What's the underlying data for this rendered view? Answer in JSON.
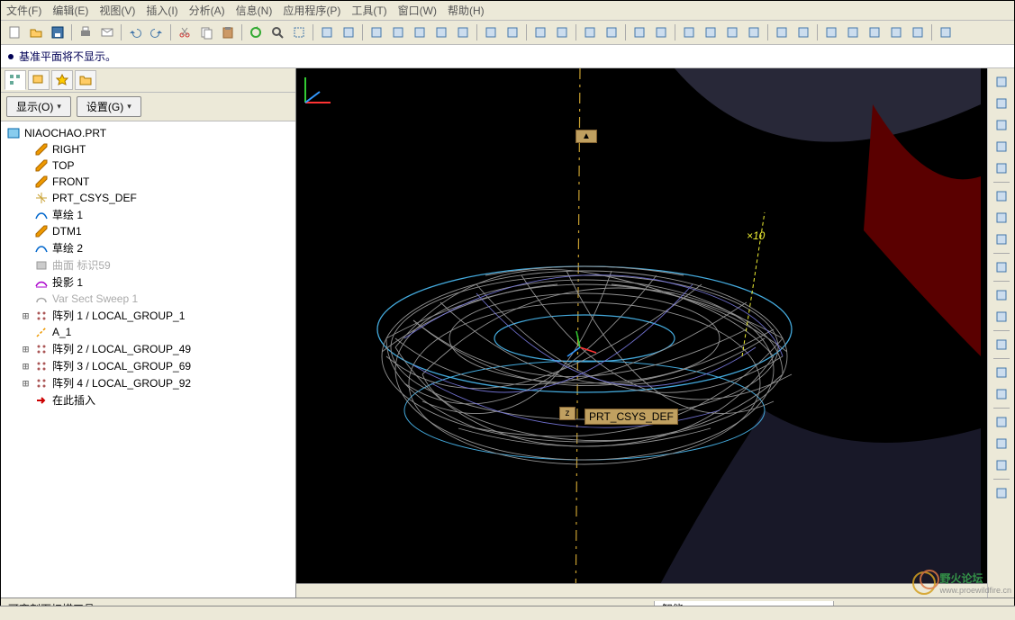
{
  "menu": [
    "文件(F)",
    "编辑(E)",
    "视图(V)",
    "插入(I)",
    "分析(A)",
    "信息(N)",
    "应用程序(P)",
    "工具(T)",
    "窗口(W)",
    "帮助(H)"
  ],
  "message": "基准平面将不显示。",
  "controls": {
    "show": "显示(O)",
    "settings": "设置(G)"
  },
  "tree_root": "NIAOCHAO.PRT",
  "tree_items": [
    {
      "icon": "plane",
      "label": "RIGHT",
      "faded": false
    },
    {
      "icon": "plane",
      "label": "TOP",
      "faded": false
    },
    {
      "icon": "plane",
      "label": "FRONT",
      "faded": false
    },
    {
      "icon": "csys",
      "label": "PRT_CSYS_DEF",
      "faded": false
    },
    {
      "icon": "sketch",
      "label": "草绘 1",
      "faded": false
    },
    {
      "icon": "plane",
      "label": "DTM1",
      "faded": false
    },
    {
      "icon": "sketch",
      "label": "草绘 2",
      "faded": false
    },
    {
      "icon": "surf",
      "label": "曲面 标识59",
      "faded": true
    },
    {
      "icon": "proj",
      "label": "投影 1",
      "faded": false
    },
    {
      "icon": "sweep",
      "label": "Var Sect Sweep 1",
      "faded": true
    },
    {
      "icon": "pattern",
      "label": "阵列 1 / LOCAL_GROUP_1",
      "faded": false,
      "exp": true
    },
    {
      "icon": "axis",
      "label": "A_1",
      "faded": false
    },
    {
      "icon": "pattern",
      "label": "阵列 2 / LOCAL_GROUP_49",
      "faded": false,
      "exp": true
    },
    {
      "icon": "pattern",
      "label": "阵列 3 / LOCAL_GROUP_69",
      "faded": false,
      "exp": true
    },
    {
      "icon": "pattern",
      "label": "阵列 4 / LOCAL_GROUP_92",
      "faded": false,
      "exp": true
    },
    {
      "icon": "insert",
      "label": "在此插入",
      "faded": false
    }
  ],
  "viewport_label": "PRT_CSYS_DEF",
  "viewport_annot": "×10",
  "status": {
    "left": "可变剖面扫描工具",
    "mode": "智能"
  },
  "watermark": {
    "title": "野火论坛",
    "url": "www.proewildfire.cn"
  },
  "toolbar_icons": [
    "new",
    "open",
    "save",
    "sep",
    "print",
    "mail",
    "sep",
    "undo",
    "redo",
    "sep",
    "cut",
    "copy",
    "paste",
    "sep",
    "regen",
    "find",
    "select",
    "sep",
    "layer",
    "view",
    "sep",
    "zoom-in",
    "zoom-out",
    "fit",
    "pan",
    "rotate",
    "sep",
    "named-view",
    "saved-view",
    "sep",
    "spin",
    "center",
    "sep",
    "orient",
    "appearance",
    "sep",
    "repaint",
    "shade",
    "sep",
    "datum-plane",
    "datum-axis",
    "datum-point",
    "datum-csys",
    "sep",
    "annot",
    "hlr",
    "sep",
    "a1",
    "a2",
    "a3",
    "a4",
    "a5",
    "sep",
    "help"
  ],
  "right_icons": [
    "sketch-line",
    "sketch-rect",
    "sketch-circle",
    "sketch-arc",
    "sketch-spline",
    "sep",
    "point",
    "csys",
    "dimension",
    "sep",
    "chain",
    "sep",
    "extrude",
    "revolve",
    "sep",
    "trim",
    "sep",
    "mirror",
    "pattern",
    "sep",
    "round",
    "chamfer",
    "shell",
    "sep",
    "hole"
  ]
}
